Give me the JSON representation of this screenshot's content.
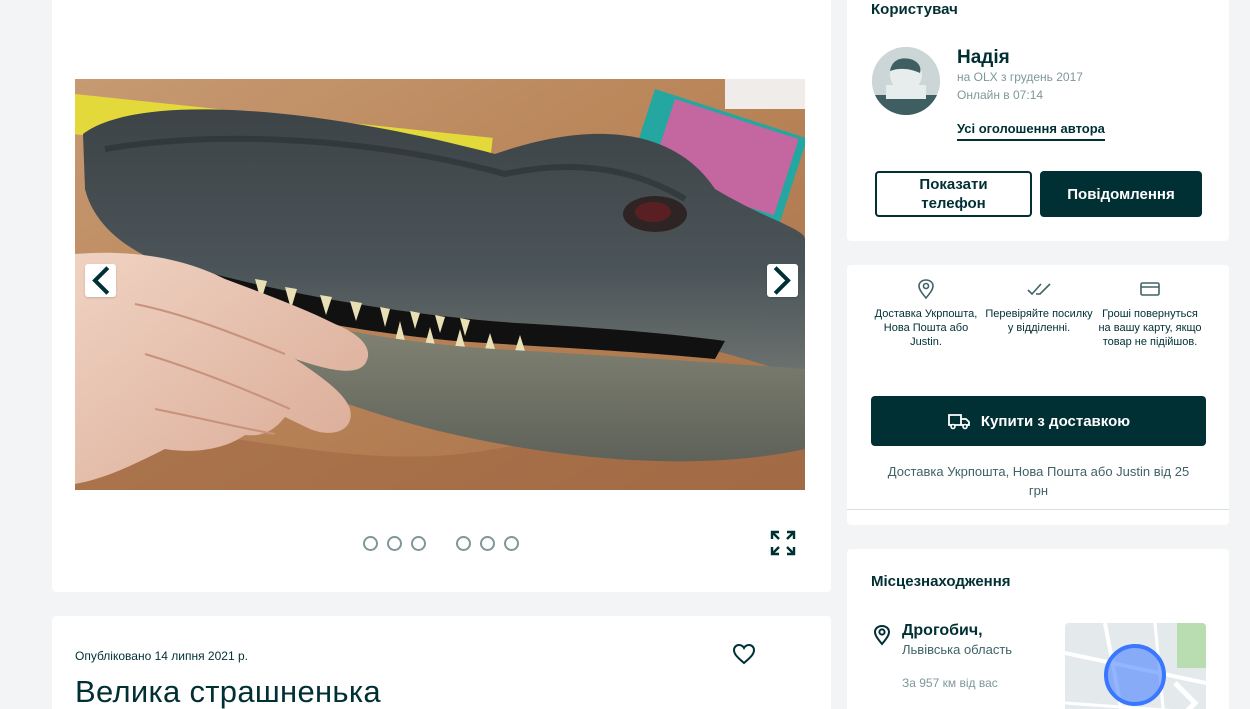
{
  "gallery": {
    "prev_label": "previous-photo",
    "next_label": "next-photo",
    "dots": 6
  },
  "ad": {
    "published": "Опубліковано 14 липня 2021 р.",
    "title": "Велика страшненька"
  },
  "user": {
    "heading": "Користувач",
    "name": "Надія",
    "since": "на OLX з грудень 2017",
    "online": "Онлайн в 07:14",
    "all_ads": "Усі оголошення автора",
    "phone_line1": "Показати",
    "phone_line2": "телефон",
    "message": "Повідомлення"
  },
  "delivery": {
    "features": [
      {
        "icon": "location-pin-icon",
        "text": "Доставка Укрпошта, Нова Пошта або Justin."
      },
      {
        "icon": "double-check-icon",
        "text": "Перевіряйте посилку у відділенні."
      },
      {
        "icon": "card-icon",
        "text": "Гроші повернуться на вашу карту, якщо товар не підійшов."
      }
    ],
    "buy_label": "Купити з доставкою",
    "note": "Доставка Укрпошта, Нова Пошта або Justin від 25 грн"
  },
  "location": {
    "heading": "Місцезнаходження",
    "city": "Дрогобич,",
    "region": "Львівська область",
    "distance": "За 957 км від вас"
  },
  "colors": {
    "primary": "#002f34",
    "background": "#f2f4f5",
    "muted": "#7f9799",
    "map_circle": "#3a77ff"
  }
}
